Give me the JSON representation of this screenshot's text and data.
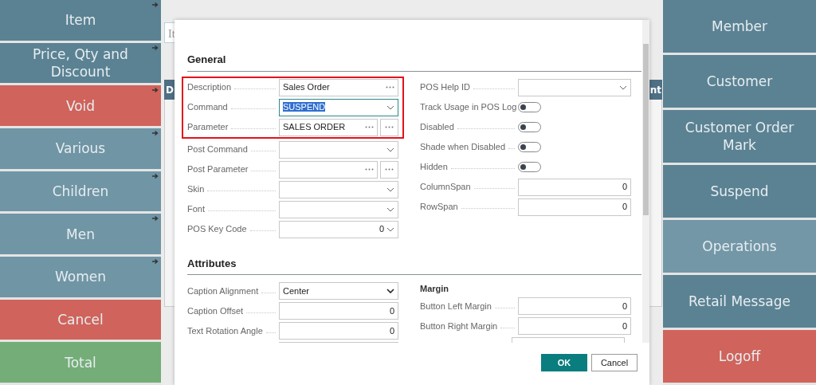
{
  "left_tiles": [
    {
      "label": "Item",
      "color": "#5b8293",
      "has_submenu": true
    },
    {
      "label": "Price, Qty and Discount",
      "color": "#5b8293",
      "has_submenu": true
    },
    {
      "label": "Void",
      "color": "#d0635b",
      "has_submenu": true
    },
    {
      "label": "Various",
      "color": "#7095a5",
      "has_submenu": true
    },
    {
      "label": "Children",
      "color": "#7095a5",
      "has_submenu": true
    },
    {
      "label": "Men",
      "color": "#7095a5",
      "has_submenu": true
    },
    {
      "label": "Women",
      "color": "#7095a5",
      "has_submenu": true
    },
    {
      "label": "Cancel",
      "color": "#d0635b",
      "has_submenu": false
    },
    {
      "label": "Total",
      "color": "#74ad77",
      "has_submenu": false
    }
  ],
  "background": {
    "search_placeholder": "It",
    "table_columns": [
      "D",
      "nt"
    ]
  },
  "right_tiles": [
    {
      "label": "Member",
      "color": "#5b8293"
    },
    {
      "label": "Customer",
      "color": "#5b8293"
    },
    {
      "label": "Customer Order Mark",
      "color": "#5b8293"
    },
    {
      "label": "Suspend",
      "color": "#5b8293"
    },
    {
      "label": "Operations",
      "color": "#7397a7"
    },
    {
      "label": "Retail Message",
      "color": "#5b8293"
    },
    {
      "label": "Logoff",
      "color": "#d0635b"
    }
  ],
  "dialog": {
    "general": {
      "title": "General",
      "highlighted_rows": [
        {
          "label": "Description",
          "kind": "lookup",
          "value": "Sales Order",
          "focused": false
        },
        {
          "label": "Command",
          "kind": "select",
          "value": "SUSPEND",
          "focused": true
        },
        {
          "label": "Parameter",
          "kind": "assist",
          "value": "SALES ORDER",
          "focused": false
        }
      ],
      "left_rows": [
        {
          "label": "Post Command",
          "kind": "select"
        },
        {
          "label": "Post Parameter",
          "kind": "assist"
        },
        {
          "label": "Skin",
          "kind": "select"
        },
        {
          "label": "Font",
          "kind": "select"
        },
        {
          "label": "POS Key Code",
          "kind": "number_select",
          "value": "0"
        }
      ],
      "right_rows": [
        {
          "label": "POS Help ID",
          "kind": "select"
        },
        {
          "label": "Track Usage in POS Log",
          "kind": "toggle",
          "on": false
        },
        {
          "label": "Disabled",
          "kind": "toggle",
          "on": false
        },
        {
          "label": "Shade when Disabled",
          "kind": "toggle",
          "on": false
        },
        {
          "label": "Hidden",
          "kind": "toggle",
          "on": false
        },
        {
          "label": "ColumnSpan",
          "kind": "number",
          "value": "0"
        },
        {
          "label": "RowSpan",
          "kind": "number",
          "value": "0"
        }
      ]
    },
    "attributes": {
      "title": "Attributes",
      "left_rows": [
        {
          "label": "Caption Alignment",
          "kind": "dropdown",
          "value": "Center"
        },
        {
          "label": "Caption Offset",
          "kind": "number",
          "value": "0"
        },
        {
          "label": "Text Rotation Angle",
          "kind": "number",
          "value": "0"
        },
        {
          "kind": "partial"
        }
      ],
      "right_heading": "Margin",
      "right_rows": [
        {
          "label": "Button Left Margin",
          "kind": "number",
          "value": "0"
        },
        {
          "label": "Button Right Margin",
          "kind": "number",
          "value": "0"
        },
        {
          "kind": "partial"
        }
      ]
    },
    "buttons": [
      {
        "label": "OK",
        "primary": true
      },
      {
        "label": "Cancel",
        "primary": false
      }
    ]
  }
}
